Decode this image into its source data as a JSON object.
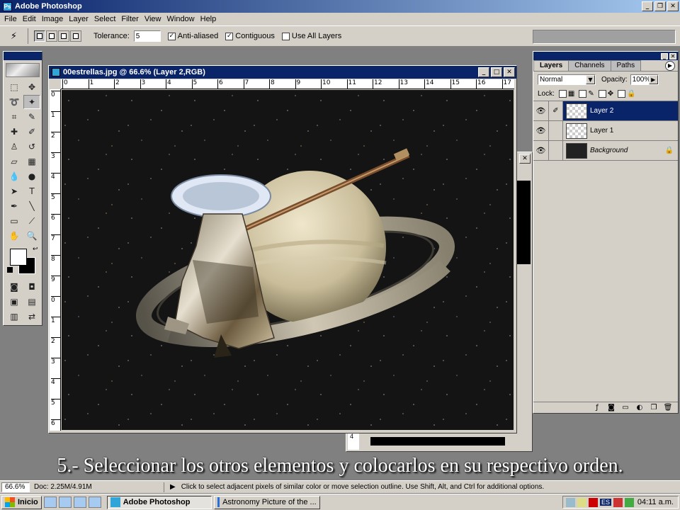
{
  "app": {
    "title": "Adobe Photoshop",
    "icon": "photoshop-icon"
  },
  "menu": [
    "File",
    "Edit",
    "Image",
    "Layer",
    "Select",
    "Filter",
    "View",
    "Window",
    "Help"
  ],
  "options": {
    "tolerance_label": "Tolerance:",
    "tolerance_value": "5",
    "anti_aliased": "Anti-aliased",
    "contiguous": "Contiguous",
    "use_all_layers": "Use All Layers"
  },
  "document": {
    "title": "00estrellas.jpg @ 66.6% (Layer 2,RGB)",
    "ruler_h": [
      "0",
      "1",
      "2",
      "3",
      "4",
      "5",
      "6",
      "7",
      "8",
      "9",
      "10",
      "11",
      "12",
      "13",
      "14",
      "15",
      "16",
      "17"
    ],
    "ruler_v": [
      "0",
      "1",
      "2",
      "3",
      "4",
      "5",
      "6",
      "7",
      "8",
      "9",
      "0",
      "1",
      "2",
      "3",
      "4",
      "5",
      "6"
    ]
  },
  "back_window": {
    "ruler_mark": "4"
  },
  "layers_panel": {
    "tabs": [
      "Layers",
      "Channels",
      "Paths"
    ],
    "blend_mode": "Normal",
    "opacity_label": "Opacity:",
    "opacity_value": "100%",
    "lock_label": "Lock:",
    "layers": [
      {
        "name": "Layer 2",
        "selected": true
      },
      {
        "name": "Layer 1",
        "selected": false
      },
      {
        "name": "Background",
        "selected": false
      }
    ]
  },
  "caption": "5.- Seleccionar los otros elementos y colocarlos en su respectivo orden.",
  "status": {
    "zoom": "66.6%",
    "doc": "Doc: 2.25M/4.91M",
    "hint": "Click to select adjacent pixels of similar color or move selection outline.  Use Shift, Alt, and Ctrl for additional options."
  },
  "taskbar": {
    "start": "Inicio",
    "tasks": [
      "Adobe Photoshop",
      "Astronomy Picture of the ..."
    ],
    "lang": "ES",
    "clock": "04:11 a.m."
  }
}
